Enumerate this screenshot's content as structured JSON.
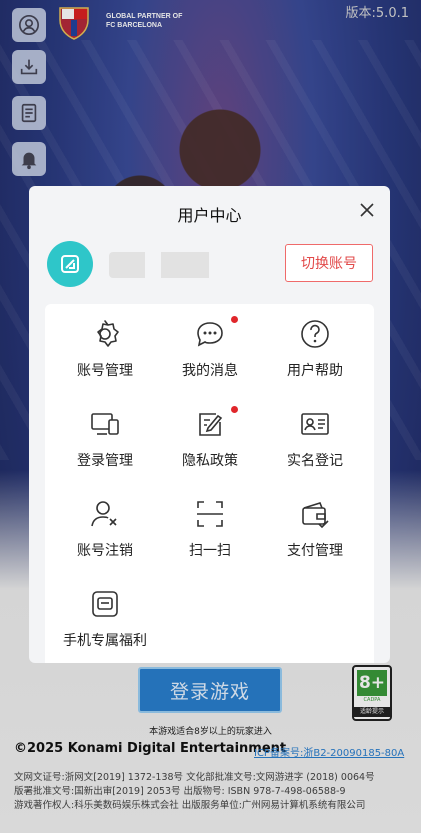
{
  "version_label": "版本:5.0.1",
  "partner": {
    "line1": "GLOBAL PARTNER OF",
    "line2": "FC BARCELONA"
  },
  "side_buttons": [
    "user-circle-icon",
    "download-tray-icon",
    "notice-doc-icon",
    "bell-icon"
  ],
  "dialog": {
    "title": "用户中心",
    "switch_account_label": "切换账号",
    "items": [
      {
        "label": "账号管理",
        "icon": "gear-icon",
        "badge": false
      },
      {
        "label": "我的消息",
        "icon": "chat-bubble-icon",
        "badge": true
      },
      {
        "label": "用户帮助",
        "icon": "help-circle-icon",
        "badge": false
      },
      {
        "label": "登录管理",
        "icon": "devices-icon",
        "badge": false
      },
      {
        "label": "隐私政策",
        "icon": "edit-document-icon",
        "badge": true
      },
      {
        "label": "实名登记",
        "icon": "id-card-icon",
        "badge": false
      },
      {
        "label": "账号注销",
        "icon": "user-remove-icon",
        "badge": false
      },
      {
        "label": "扫一扫",
        "icon": "scan-icon",
        "badge": false
      },
      {
        "label": "支付管理",
        "icon": "wallet-icon",
        "badge": false
      },
      {
        "label": "手机专属福利",
        "icon": "phone-gift-icon",
        "badge": false
      }
    ]
  },
  "login_button_label": "登录游戏",
  "age_rating": {
    "number": "8+",
    "cadpa": "CADPA",
    "tip": "适龄提示"
  },
  "age_note": "本游戏适合8岁以上的玩家进入",
  "copyright": "©2025 Konami Digital Entertainment",
  "icp": "ICP备案号:浙B2-20090185-80A",
  "license_lines": [
    "文网文证号:浙网文[2019] 1372-138号   文化部批准文号:文网游进字 (2018) 0064号",
    "版署批准文号:国新出审[2019] 2053号   出版物号: ISBN 978-7-498-06588-9",
    "游戏著作权人:科乐美数码娱乐株式会社 出版服务单位:广州网易计算机系统有限公司"
  ],
  "colors": {
    "accent_red": "#e24a4a",
    "avatar_teal": "#2ec6c9",
    "login_blue": "#2a7fcf",
    "badge_dot": "#e0262b"
  }
}
